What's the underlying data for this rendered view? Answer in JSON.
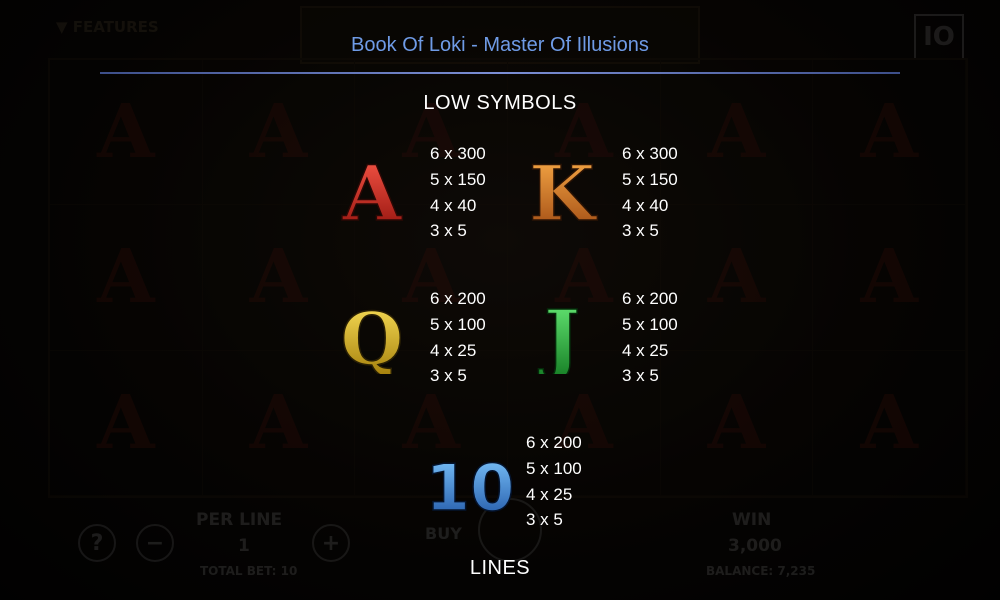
{
  "background": {
    "features_label": "▼ FEATURES",
    "io_badge": "IO",
    "per_line_label": "PER LINE",
    "per_line_value": "1",
    "total_bet": "TOTAL BET: 10",
    "buy_label": "BUY",
    "win_label": "WIN",
    "win_value": "3,000",
    "balance": "BALANCE: 7,235",
    "help_button": "?",
    "minus_button": "−",
    "plus_button": "+"
  },
  "title": "Book Of Loki - Master Of Illusions",
  "sections": {
    "low_symbols": "LOW SYMBOLS",
    "lines": "LINES"
  },
  "symbols": [
    {
      "id": "A",
      "glyph": "A",
      "color_top": "#ff5a4a",
      "color_bottom": "#8c0f0a",
      "pays": [
        "6 x 300",
        "5 x 150",
        "4 x 40",
        "3 x 5"
      ]
    },
    {
      "id": "K",
      "glyph": "K",
      "color_top": "#ffb04a",
      "color_bottom": "#9a4510",
      "pays": [
        "6 x 300",
        "5 x 150",
        "4 x 40",
        "3 x 5"
      ]
    },
    {
      "id": "Q",
      "glyph": "Q",
      "color_top": "#ffe55c",
      "color_bottom": "#a07a08",
      "pays": [
        "6 x 200",
        "5 x 100",
        "4 x 25",
        "3 x 5"
      ]
    },
    {
      "id": "J",
      "glyph": "J",
      "color_top": "#6cf07a",
      "color_bottom": "#137a22",
      "pays": [
        "6 x 200",
        "5 x 100",
        "4 x 25",
        "3 x 5"
      ]
    },
    {
      "id": "10",
      "glyph": "10",
      "color_top": "#7fc8ff",
      "color_bottom": "#1a4fa0",
      "pays": [
        "6 x 200",
        "5 x 100",
        "4 x 25",
        "3 x 5"
      ]
    }
  ],
  "colors": {
    "title": "#6f9be6",
    "text": "#ffffff",
    "divider": "#7c8fd6"
  }
}
